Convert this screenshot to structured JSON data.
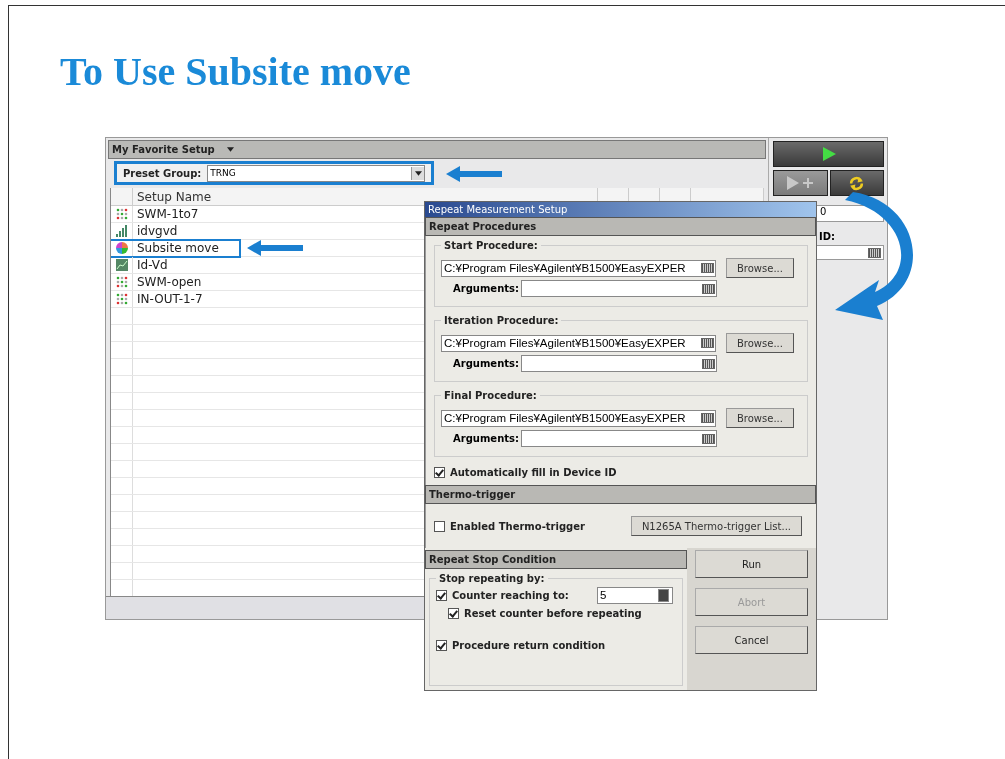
{
  "slide": {
    "title": "To Use Subsite move"
  },
  "favorites": {
    "title": "My Favorite Setup",
    "preset_label": "Preset Group:",
    "preset_value": "TRNG",
    "column": "Setup Name",
    "setups": [
      {
        "name": "SWM-1to7",
        "kind": "matrix",
        "highlighted": false
      },
      {
        "name": "idvgvd",
        "kind": "bars",
        "highlighted": false
      },
      {
        "name": "Subsite move",
        "kind": "wheel",
        "highlighted": true
      },
      {
        "name": "Id-Vd",
        "kind": "plot",
        "highlighted": false
      },
      {
        "name": "SWM-open",
        "kind": "matrix",
        "highlighted": false
      },
      {
        "name": "IN-OUT-1-7",
        "kind": "matrix",
        "highlighted": false
      }
    ]
  },
  "side_panel": {
    "field_value": "0",
    "field_label": "ID:"
  },
  "dialog": {
    "title": "Repeat Measurement Setup",
    "procedures_header": "Repeat Procedures",
    "procedures": [
      {
        "title": "Start Procedure:",
        "path": "C:¥Program Files¥Agilent¥B1500¥EasyEXPER",
        "arguments_label": "Arguments:",
        "browse": "Browse..."
      },
      {
        "title": "Iteration Procedure:",
        "path": "C:¥Program Files¥Agilent¥B1500¥EasyEXPER",
        "arguments_label": "Arguments:",
        "browse": "Browse..."
      },
      {
        "title": "Final Procedure:",
        "path": "C:¥Program Files¥Agilent¥B1500¥EasyEXPER",
        "arguments_label": "Arguments:",
        "browse": "Browse..."
      }
    ],
    "auto_fill": {
      "label": "Automatically fill in Device ID",
      "checked": true
    },
    "thermo": {
      "header": "Thermo-trigger",
      "label": "Enabled Thermo-trigger",
      "checked": false,
      "list_button": "N1265A Thermo-trigger List..."
    },
    "stop": {
      "header": "Repeat Stop Condition",
      "group_title": "Stop repeating by:",
      "counter": {
        "label": "Counter reaching to:",
        "checked": true,
        "value": "5"
      },
      "reset": {
        "label": "Reset counter before repeating",
        "checked": true
      },
      "procedure_return": {
        "label": "Procedure return condition",
        "checked": true
      }
    },
    "buttons": [
      {
        "label": "Run",
        "disabled": false
      },
      {
        "label": "Abort",
        "disabled": true
      },
      {
        "label": "Cancel",
        "disabled": false
      }
    ]
  }
}
